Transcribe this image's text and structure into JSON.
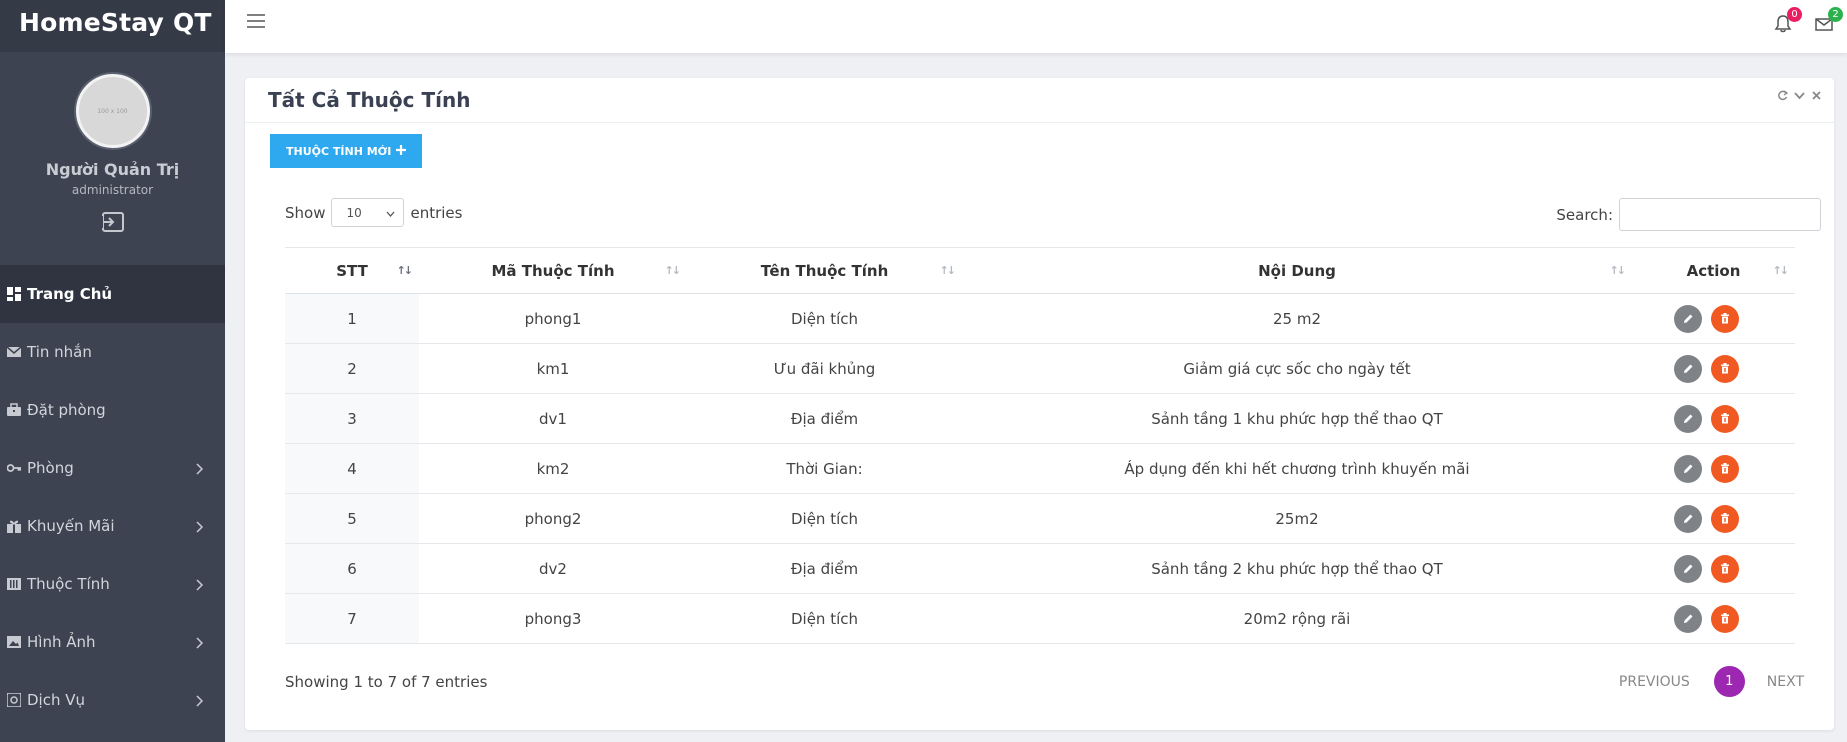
{
  "app": {
    "brand": "HomeStay QT"
  },
  "profile": {
    "avatar_text": "100 x 100",
    "name": "Người Quản Trị",
    "role": "administrator"
  },
  "sidebar": {
    "items": [
      {
        "label": "Trang Chủ",
        "icon": "dashboard-icon",
        "active": true
      },
      {
        "label": "Tin nhắn",
        "icon": "mail-icon"
      },
      {
        "label": "Đặt phòng",
        "icon": "briefcase-icon"
      },
      {
        "label": "Phòng",
        "icon": "key-icon",
        "expandable": true
      },
      {
        "label": "Khuyến Mãi",
        "icon": "gift-icon",
        "expandable": true
      },
      {
        "label": "Thuộc Tính",
        "icon": "list-icon",
        "expandable": true
      },
      {
        "label": "Hình Ảnh",
        "icon": "image-icon",
        "expandable": true
      },
      {
        "label": "Dịch Vụ",
        "icon": "service-icon",
        "expandable": true
      }
    ]
  },
  "topbar": {
    "notifications_count": "0",
    "messages_count": "2"
  },
  "card": {
    "title": "Tất Cả Thuộc Tính",
    "new_button_label": "THUỘC TÍNH MỚI"
  },
  "table_controls": {
    "show_label": "Show",
    "entries_value": "10",
    "entries_label": "entries",
    "search_label": "Search:",
    "search_value": ""
  },
  "table": {
    "headers": [
      "STT",
      "Mã Thuộc Tính",
      "Tên Thuộc Tính",
      "Nội Dung",
      "Action"
    ],
    "rows": [
      [
        "1",
        "phong1",
        "Diện tích",
        "25 m2"
      ],
      [
        "2",
        "km1",
        "Ưu đãi khủng",
        "Giảm giá cực sốc cho ngày tết"
      ],
      [
        "3",
        "dv1",
        "Địa điểm",
        "Sảnh tầng 1 khu phức hợp thể thao QT"
      ],
      [
        "4",
        "km2",
        "Thời Gian:",
        "Áp dụng đến khi hết chương trình khuyến mãi"
      ],
      [
        "5",
        "phong2",
        "Diện tích",
        "25m2"
      ],
      [
        "6",
        "dv2",
        "Địa điểm",
        "Sảnh tầng 2 khu phức hợp thể thao QT"
      ],
      [
        "7",
        "phong3",
        "Diện tích",
        "20m2 rộng rãi"
      ]
    ]
  },
  "footer": {
    "info": "Showing 1 to 7 of 7 entries",
    "previous": "PREVIOUS",
    "current_page": "1",
    "next": "NEXT"
  },
  "colors": {
    "sidebar": "#3d4351",
    "primary_button": "#2ea8ef",
    "edit_button": "#7f8287",
    "delete_button": "#f05a22",
    "active_page": "#9c27b0",
    "notif_badge": "#e91e63",
    "mail_badge": "#2bb24c"
  }
}
